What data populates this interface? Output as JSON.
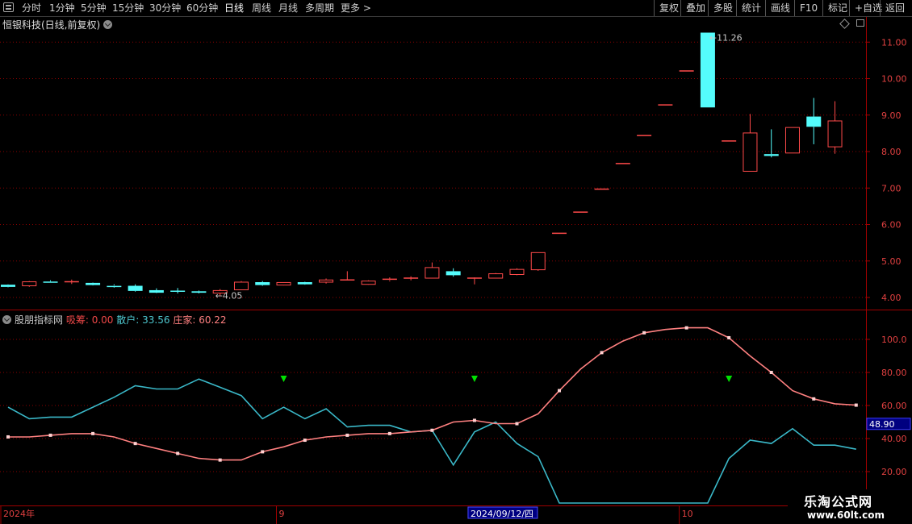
{
  "toolbar": {
    "periods": [
      "分时",
      "1分钟",
      "5分钟",
      "15分钟",
      "30分钟",
      "60分钟",
      "日线",
      "周线",
      "月线",
      "多周期",
      "更多 >"
    ],
    "active_period": "日线",
    "right_buttons": [
      "复权",
      "叠加",
      "多股",
      "统计",
      "画线",
      "F10",
      "标记",
      "+自选",
      "返回"
    ]
  },
  "main_title": "恒银科技(日线,前复权)",
  "indicator": {
    "name": "股朋指标网",
    "xichou_label": "吸筹:",
    "xichou_value": "0.00",
    "sanhu_label": "散户:",
    "sanhu_value": "33.56",
    "zhuangjia_label": "庄家:",
    "zhuangjia_value": "60.22"
  },
  "watermark": {
    "line1": "乐淘公式网",
    "line2": "www.60lt.com"
  },
  "colors": {
    "up": "#ff4a4a",
    "down": "#54fcfc",
    "grid": "#8b0000",
    "sanhu": "#3ab8c8",
    "zhuangjia": "#ff8080",
    "xichou_arrow": "#00e000"
  },
  "chart_data": [
    {
      "type": "candlestick",
      "title": "恒银科技(日线,前复权)",
      "ylim": [
        3.8,
        11.6
      ],
      "yticks": [
        "4.00",
        "5.00",
        "6.00",
        "7.00",
        "8.00",
        "9.00",
        "10.00",
        "11.00"
      ],
      "annotations": {
        "high": "11.26",
        "low": "4.05"
      },
      "candles": [
        {
          "o": 4.35,
          "h": 4.36,
          "l": 4.28,
          "c": 4.29
        },
        {
          "o": 4.32,
          "h": 4.45,
          "l": 4.29,
          "c": 4.43
        },
        {
          "o": 4.44,
          "h": 4.47,
          "l": 4.41,
          "c": 4.42
        },
        {
          "o": 4.43,
          "h": 4.49,
          "l": 4.37,
          "c": 4.43
        },
        {
          "o": 4.4,
          "h": 4.41,
          "l": 4.33,
          "c": 4.34
        },
        {
          "o": 4.33,
          "h": 4.36,
          "l": 4.27,
          "c": 4.3
        },
        {
          "o": 4.32,
          "h": 4.36,
          "l": 4.16,
          "c": 4.18
        },
        {
          "o": 4.2,
          "h": 4.25,
          "l": 4.12,
          "c": 4.13
        },
        {
          "o": 4.18,
          "h": 4.26,
          "l": 4.11,
          "c": 4.17
        },
        {
          "o": 4.17,
          "h": 4.19,
          "l": 4.11,
          "c": 4.13
        },
        {
          "o": 4.12,
          "h": 4.23,
          "l": 4.05,
          "c": 4.19
        },
        {
          "o": 4.21,
          "h": 4.45,
          "l": 4.2,
          "c": 4.42
        },
        {
          "o": 4.42,
          "h": 4.45,
          "l": 4.32,
          "c": 4.34
        },
        {
          "o": 4.34,
          "h": 4.42,
          "l": 4.33,
          "c": 4.41
        },
        {
          "o": 4.42,
          "h": 4.43,
          "l": 4.35,
          "c": 4.36
        },
        {
          "o": 4.42,
          "h": 4.52,
          "l": 4.38,
          "c": 4.48
        },
        {
          "o": 4.48,
          "h": 4.72,
          "l": 4.48,
          "c": 4.48
        },
        {
          "o": 4.36,
          "h": 4.47,
          "l": 4.35,
          "c": 4.45
        },
        {
          "o": 4.47,
          "h": 4.55,
          "l": 4.44,
          "c": 4.5
        },
        {
          "o": 4.53,
          "h": 4.58,
          "l": 4.47,
          "c": 4.53
        },
        {
          "o": 4.53,
          "h": 4.96,
          "l": 4.53,
          "c": 4.82
        },
        {
          "o": 4.72,
          "h": 4.8,
          "l": 4.57,
          "c": 4.61
        },
        {
          "o": 4.53,
          "h": 4.55,
          "l": 4.36,
          "c": 4.53
        },
        {
          "o": 4.53,
          "h": 4.67,
          "l": 4.52,
          "c": 4.65
        },
        {
          "o": 4.63,
          "h": 4.8,
          "l": 4.61,
          "c": 4.77
        },
        {
          "o": 4.76,
          "h": 5.23,
          "l": 4.73,
          "c": 5.23
        },
        {
          "o": 5.76,
          "h": 5.76,
          "l": 5.76,
          "c": 5.76
        },
        {
          "o": 6.34,
          "h": 6.34,
          "l": 6.34,
          "c": 6.34
        },
        {
          "o": 6.97,
          "h": 6.97,
          "l": 6.97,
          "c": 6.97
        },
        {
          "o": 7.67,
          "h": 7.67,
          "l": 7.67,
          "c": 7.67
        },
        {
          "o": 8.44,
          "h": 8.44,
          "l": 8.44,
          "c": 8.44
        },
        {
          "o": 9.28,
          "h": 9.28,
          "l": 9.28,
          "c": 9.28
        },
        {
          "o": 10.21,
          "h": 10.21,
          "l": 10.21,
          "c": 10.21
        },
        {
          "o": 11.26,
          "h": 11.26,
          "l": 9.21,
          "c": 9.21
        },
        {
          "o": 8.29,
          "h": 8.29,
          "l": 8.29,
          "c": 8.29
        },
        {
          "o": 7.46,
          "h": 9.03,
          "l": 7.46,
          "c": 8.51
        },
        {
          "o": 7.93,
          "h": 8.61,
          "l": 7.84,
          "c": 7.88
        },
        {
          "o": 7.96,
          "h": 8.66,
          "l": 7.96,
          "c": 8.66
        },
        {
          "o": 8.96,
          "h": 9.47,
          "l": 8.2,
          "c": 8.68
        },
        {
          "o": 8.13,
          "h": 9.38,
          "l": 7.94,
          "c": 8.84
        }
      ]
    },
    {
      "type": "line",
      "title": "股朋指标网",
      "ylim": [
        10,
        117
      ],
      "yticks": [
        "20.00",
        "40.00",
        "60.00",
        "80.00",
        "100.0"
      ],
      "cursor_value": "48.90",
      "series": [
        {
          "name": "散户",
          "values": [
            59,
            52,
            53,
            53,
            59,
            65,
            72,
            70,
            70,
            76,
            71,
            66,
            52,
            59,
            52,
            58,
            47,
            48,
            48,
            44,
            45,
            24,
            44,
            50,
            37,
            29,
            1,
            1,
            1,
            1,
            1,
            1,
            1,
            1,
            28,
            39,
            37,
            46,
            36,
            36,
            33.56
          ]
        },
        {
          "name": "庄家",
          "values": [
            41,
            41,
            42,
            43,
            43,
            41,
            37,
            34,
            31,
            28,
            27,
            27,
            32,
            35,
            39,
            41,
            42,
            43,
            43,
            44,
            45,
            50,
            51,
            49,
            49,
            55,
            69,
            82,
            92,
            99,
            104,
            106,
            107,
            107,
            101,
            90,
            80,
            69,
            64,
            61,
            60.22
          ]
        }
      ],
      "signal_days": [
        13,
        22,
        34
      ],
      "x_labels": [
        {
          "index": 0,
          "text": "2024年"
        },
        {
          "index": 13,
          "text": "9"
        },
        {
          "index": 22,
          "text": "2024/09/12/四"
        },
        {
          "index": 32,
          "text": "10"
        }
      ]
    }
  ]
}
